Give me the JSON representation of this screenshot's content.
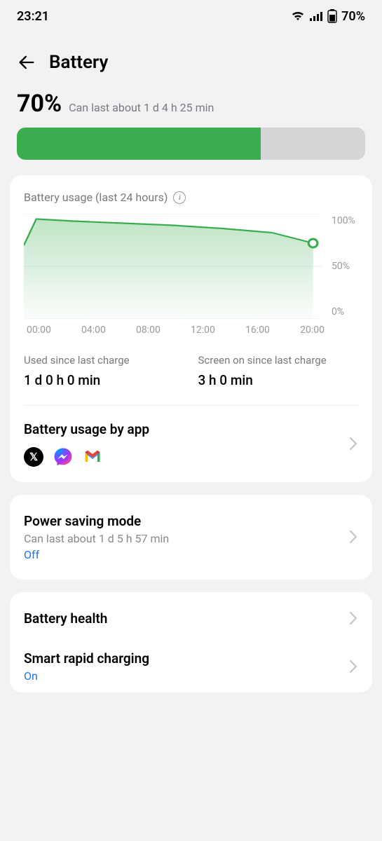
{
  "status_bar": {
    "time": "23:21",
    "battery_pct": "70%"
  },
  "header": {
    "title": "Battery"
  },
  "summary": {
    "pct": "70%",
    "estimate": "Can last about 1 d 4 h 25 min",
    "fill_pct": 70
  },
  "usage_card": {
    "title": "Battery usage (last 24 hours)",
    "y_ticks": [
      "100%",
      "50%",
      "0%"
    ],
    "x_ticks": [
      "00:00",
      "04:00",
      "08:00",
      "12:00",
      "16:00",
      "20:00"
    ],
    "used_label": "Used since last charge",
    "used_value": "1 d 0 h 0 min",
    "screen_label": "Screen on since last charge",
    "screen_value": "3 h 0 min",
    "by_app_title": "Battery usage by app",
    "apps": [
      "x",
      "messenger",
      "gmail"
    ]
  },
  "power_saving": {
    "title": "Power saving mode",
    "sub": "Can last about 1 d 5 h 57 min",
    "status": "Off"
  },
  "battery_health": {
    "title": "Battery health"
  },
  "smart_rapid": {
    "title": "Smart rapid charging",
    "status": "On"
  },
  "chart_data": {
    "type": "area",
    "x": [
      0,
      1,
      4,
      8,
      12,
      16,
      20,
      22,
      23.3
    ],
    "values": [
      70,
      95,
      93,
      91,
      89,
      86,
      82,
      76,
      72
    ],
    "xlabel": "Hour",
    "ylabel": "Battery %",
    "xlim": [
      0,
      24
    ],
    "ylim": [
      0,
      100
    ],
    "current_point": {
      "x": 23.3,
      "y": 72
    }
  },
  "colors": {
    "accent_green": "#3aad4e",
    "link_blue": "#1a74ff"
  }
}
